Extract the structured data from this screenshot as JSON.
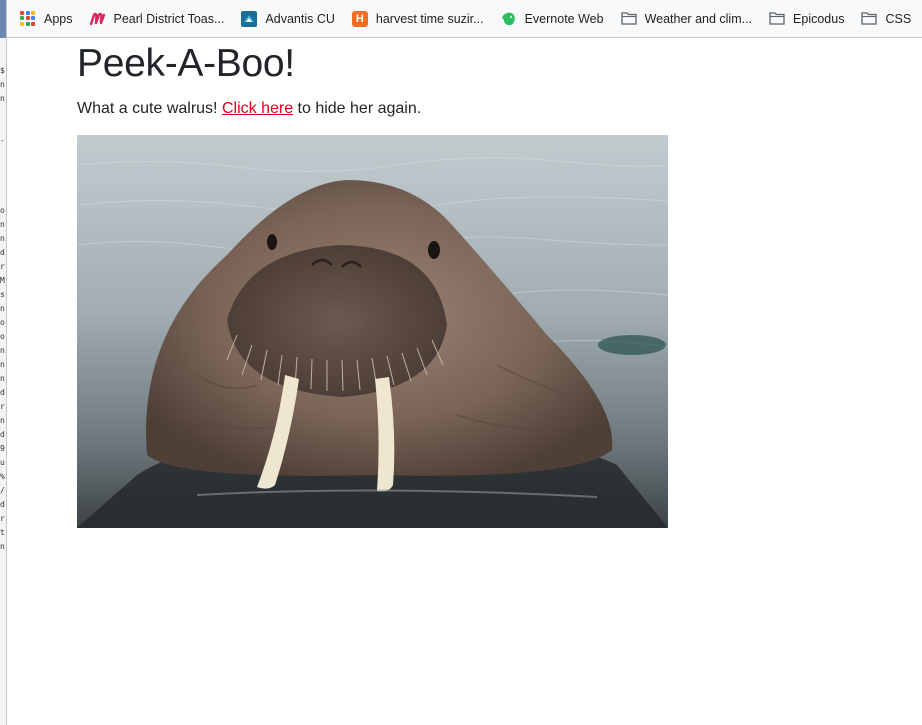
{
  "bookmarks": [
    {
      "label": "Apps",
      "icon": "apps-grid-icon"
    },
    {
      "label": "Pearl District Toas...",
      "icon": "pearl-district-logo-icon"
    },
    {
      "label": "Advantis CU",
      "icon": "advantis-cu-logo-icon"
    },
    {
      "label": "harvest time suzir...",
      "icon": "harvest-h-logo-icon"
    },
    {
      "label": "Evernote Web",
      "icon": "evernote-elephant-icon"
    },
    {
      "label": "Weather and clim...",
      "icon": "folder-icon"
    },
    {
      "label": "Epicodus",
      "icon": "folder-icon"
    },
    {
      "label": "CSS",
      "icon": "folder-icon"
    }
  ],
  "page": {
    "title": "Peek-A-Boo!",
    "text_before": "What a cute walrus! ",
    "link_text": "Click here",
    "text_after": " to hide her again.",
    "image_description": "walrus-photo"
  },
  "left_strip_glyphs": [
    "$",
    "n",
    "n",
    "-",
    "o",
    "n",
    "n",
    "d",
    "r",
    "M",
    "s",
    "n",
    "o",
    "o",
    "n",
    "n",
    "n",
    "d",
    "r",
    "n",
    "d",
    "9",
    "u",
    "%",
    "/",
    "d",
    "r",
    "t",
    "n"
  ],
  "colors": {
    "link": "#e0001b",
    "text": "#212529",
    "bookmarks_bg": "#f8f9fa"
  }
}
